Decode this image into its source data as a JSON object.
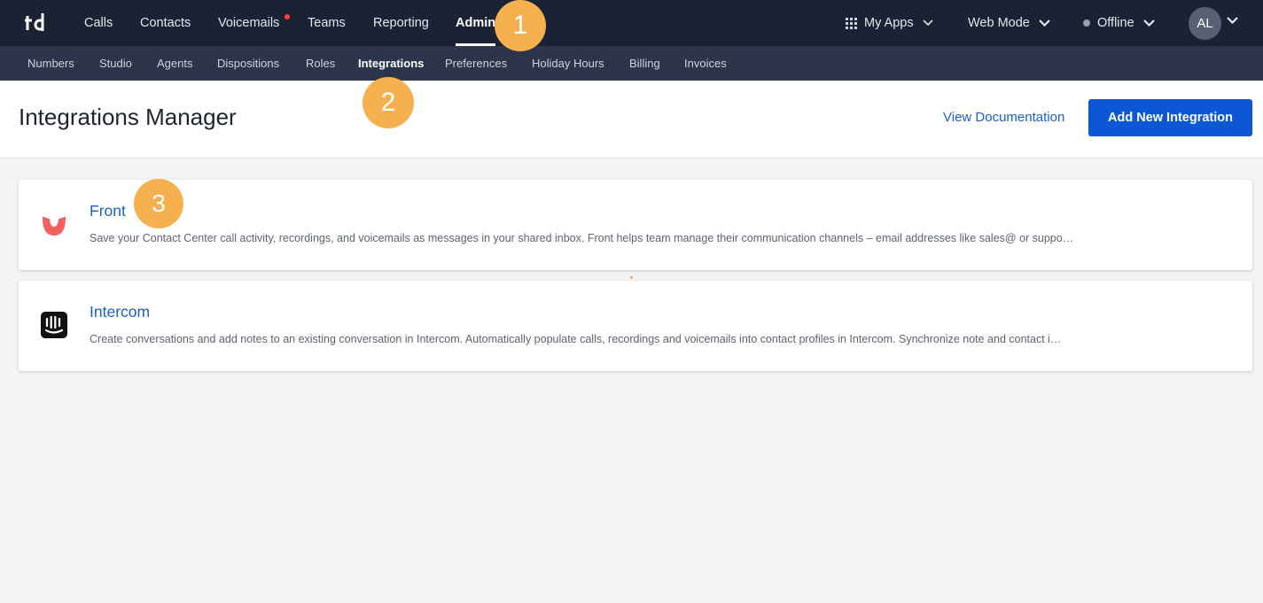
{
  "app": {
    "logo_text": "td"
  },
  "topnav": {
    "items": [
      "Calls",
      "Contacts",
      "Voicemails",
      "Teams",
      "Reporting",
      "Admin"
    ],
    "active": "Admin",
    "my_apps": "My Apps",
    "web_mode": "Web Mode",
    "status": "Offline",
    "avatar_initials": "AL"
  },
  "subnav": {
    "items": [
      "Numbers",
      "Studio",
      "Agents",
      "Dispositions",
      "Roles",
      "Integrations",
      "Preferences",
      "Holiday Hours",
      "Billing",
      "Invoices"
    ],
    "active": "Integrations"
  },
  "header": {
    "title": "Integrations Manager",
    "doc_link": "View Documentation",
    "add_button": "Add New Integration"
  },
  "integrations": [
    {
      "name": "Front",
      "description": "Save your Contact Center call activity, recordings, and voicemails as messages in your shared inbox. Front helps team manage their communication channels – email addresses like sales@ or suppo…",
      "icon": "front-logo-icon"
    },
    {
      "name": "Intercom",
      "description": "Create conversations and add notes to an existing conversation in Intercom. Automatically populate calls, recordings and voicemails into contact profiles in Intercom. Synchronize note and contact i…",
      "icon": "intercom-logo-icon"
    }
  ],
  "steps": [
    "1",
    "2",
    "3"
  ],
  "colors": {
    "topbar": "#1b2234",
    "subbar": "#2c3549",
    "accent": "#0b57d6",
    "link": "#1a5fc8",
    "step_marker": "#f6b14e",
    "notification_dot": "#ff3b3b"
  }
}
